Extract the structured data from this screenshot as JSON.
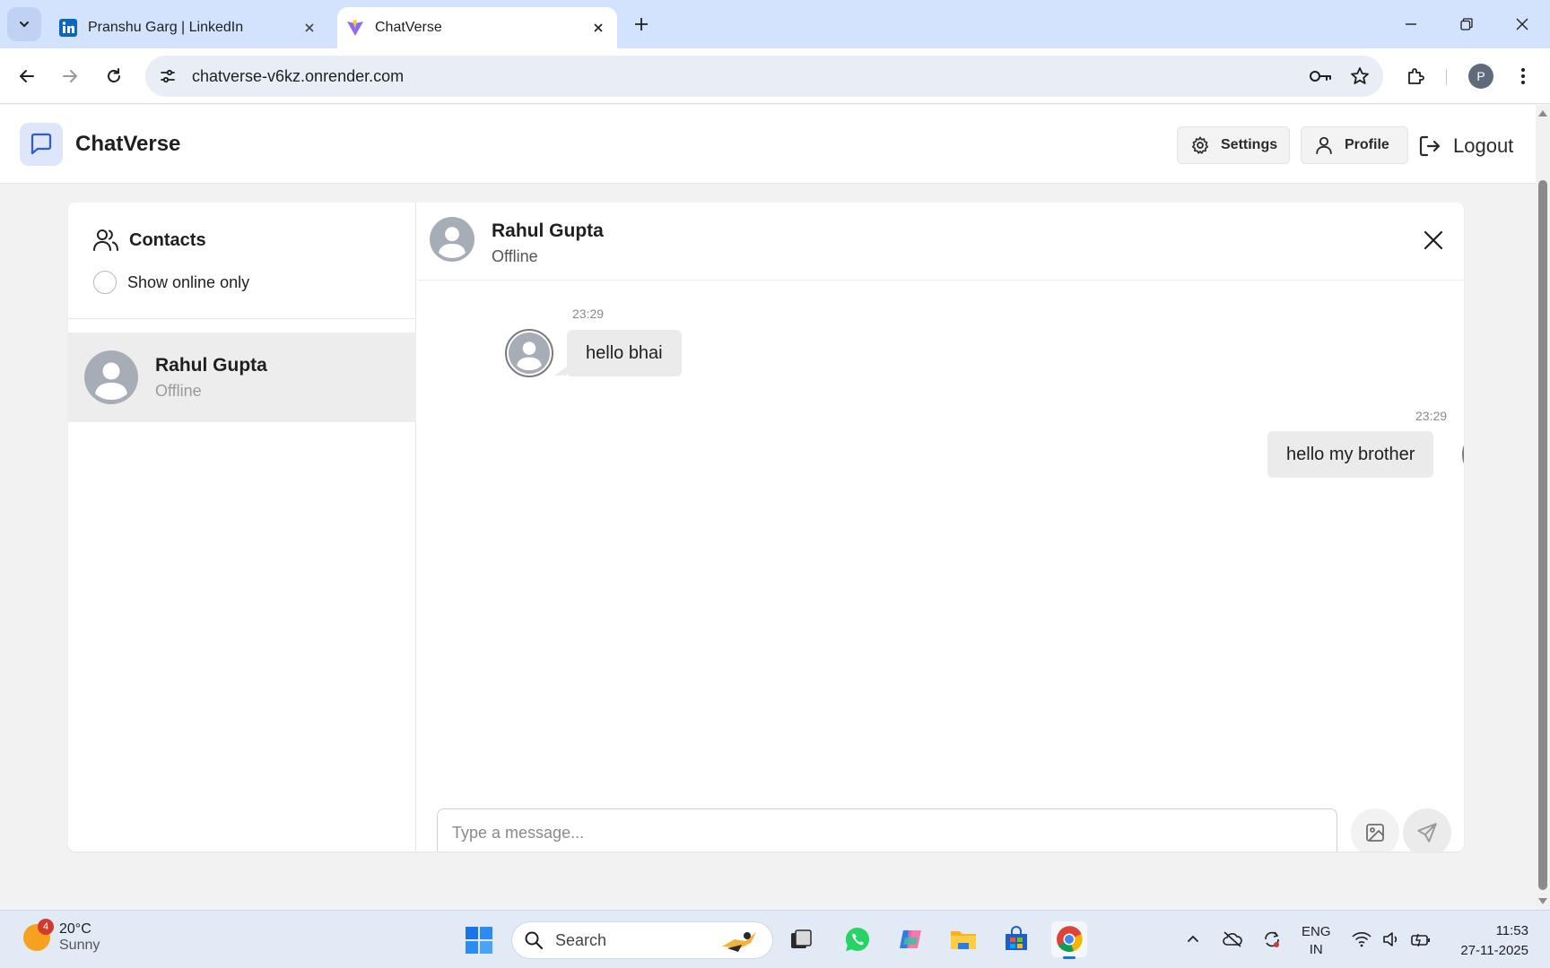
{
  "browser": {
    "tabs": [
      {
        "title": "Pranshu Garg | LinkedIn",
        "active": false,
        "icon": "linkedin-icon"
      },
      {
        "title": "ChatVerse",
        "active": true,
        "icon": "vite-icon"
      }
    ],
    "url": "chatverse-v6kz.onrender.com",
    "profile_initial": "P"
  },
  "app": {
    "title": "ChatVerse",
    "header": {
      "settings_label": "Settings",
      "profile_label": "Profile",
      "logout_label": "Logout"
    },
    "sidebar": {
      "title": "Contacts",
      "online_only_label": "Show online only",
      "online_only_checked": false,
      "contacts": [
        {
          "name": "Rahul Gupta",
          "status": "Offline"
        }
      ]
    },
    "chat": {
      "contact_name": "Rahul Gupta",
      "contact_status": "Offline",
      "messages": [
        {
          "direction": "incoming",
          "time": "23:29",
          "text": "hello bhai"
        },
        {
          "direction": "outgoing",
          "time": "23:29",
          "text": "hello my brother"
        }
      ],
      "input_placeholder": "Type a message...",
      "input_value": ""
    }
  },
  "taskbar": {
    "weather_temp": "20°C",
    "weather_desc": "Sunny",
    "weather_badge": "4",
    "search_label": "Search",
    "lang_line1": "ENG",
    "lang_line2": "IN",
    "time": "11:53",
    "date": "27-11-2025"
  },
  "colors": {
    "tabbar_bg": "#d3e3fd",
    "app_bg": "#f2f2f2",
    "logo_accent": "#2d5bd6",
    "bubble_bg": "#ebebeb",
    "taskbar_bg": "#e2eaf6"
  }
}
